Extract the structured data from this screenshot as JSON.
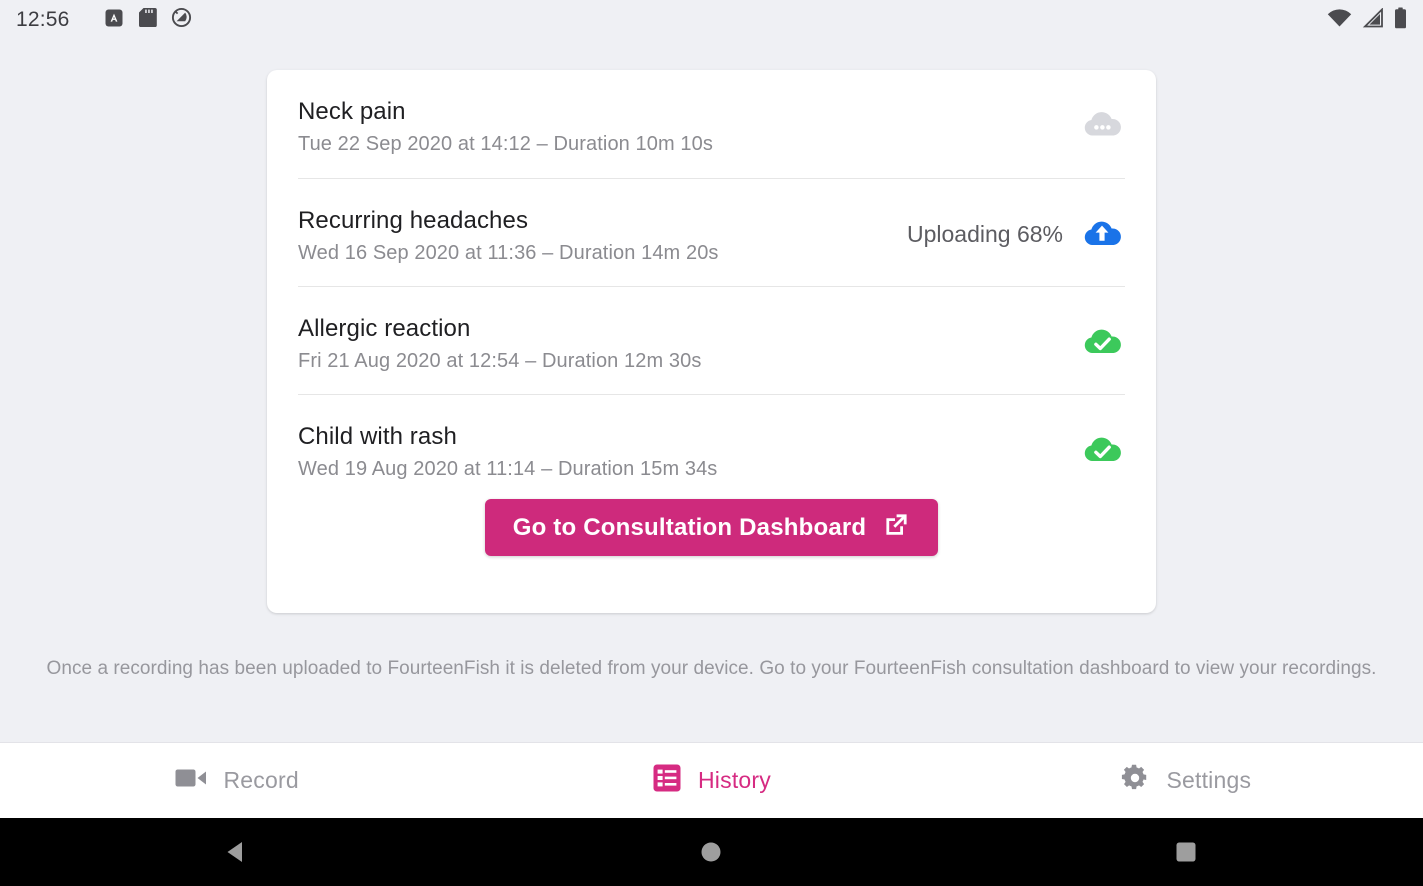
{
  "statusbar": {
    "time": "12:56",
    "left_icons": [
      "screenshot-icon",
      "sd-card-icon",
      "do-not-disturb-icon"
    ],
    "right_icons": [
      "wifi-icon",
      "cell-signal-icon",
      "battery-icon"
    ]
  },
  "recordings": [
    {
      "title": "Neck pain",
      "subtitle": "Tue 22 Sep 2020 at 14:12 – Duration 10m 10s",
      "status_text": "",
      "icon": "cloud-pending-icon",
      "icon_color": "#d7d8dd"
    },
    {
      "title": "Recurring headaches",
      "subtitle": "Wed 16 Sep 2020 at 11:36 – Duration 14m 20s",
      "status_text": "Uploading 68%",
      "icon": "cloud-upload-icon",
      "icon_color": "#1a73e8"
    },
    {
      "title": "Allergic reaction",
      "subtitle": "Fri 21 Aug 2020 at 12:54 – Duration 12m 30s",
      "status_text": "",
      "icon": "cloud-done-icon",
      "icon_color": "#3cc95b"
    },
    {
      "title": "Child with rash",
      "subtitle": "Wed 19 Aug 2020 at 11:14 – Duration 15m 34s",
      "status_text": "",
      "icon": "cloud-done-icon",
      "icon_color": "#3cc95b"
    }
  ],
  "cta": {
    "label": "Go to Consultation Dashboard",
    "icon": "external-link-icon",
    "color": "#ce2a7c"
  },
  "footnote": "Once a recording has been uploaded to FourteenFish it is deleted from your device. Go to your FourteenFish consultation dashboard to view your recordings.",
  "bottom_nav": {
    "active_color": "#d62b82",
    "inactive_color": "#9a9aa0",
    "items": [
      {
        "label": "Record",
        "icon": "videocam-icon",
        "active": false
      },
      {
        "label": "History",
        "icon": "list-icon",
        "active": true
      },
      {
        "label": "Settings",
        "icon": "gear-icon",
        "active": false
      }
    ]
  },
  "system_nav": {
    "buttons": [
      {
        "icon": "back-icon"
      },
      {
        "icon": "home-icon"
      },
      {
        "icon": "recents-icon"
      }
    ]
  }
}
